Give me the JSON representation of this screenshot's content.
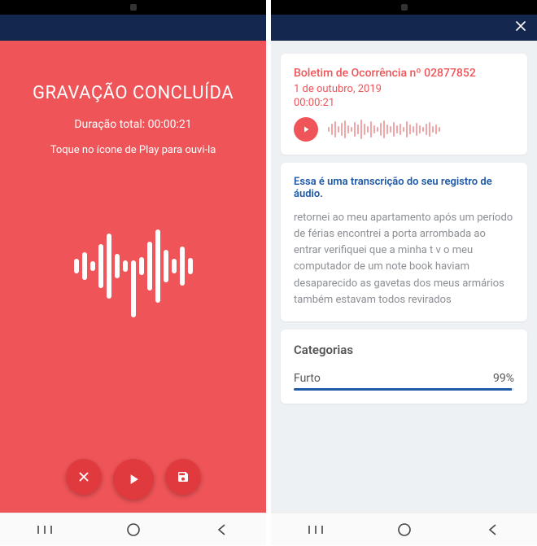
{
  "left": {
    "title": "GRAVAÇÃO CONCLUÍDA",
    "duration_label": "Duração total: 00:00:21",
    "hint": "Toque no ícone de Play para ouvi-la"
  },
  "right": {
    "report_title": "Boletim de Ocorrência nº 02877852",
    "report_date": "1 de outubro, 2019",
    "report_duration": "00:00:21",
    "transcription_title": "Essa é uma transcrição do seu registro de áudio.",
    "transcription_body": "retornei ao meu apartamento após um período de férias encontrei a porta arrombada ao entrar verifiquei que a minha t v o meu computador de um note book haviam desaparecido as gavetas dos meus armários também estavam todos revirados",
    "categories_title": "Categorias",
    "category_name": "Furto",
    "category_pct_label": "99%",
    "category_pct": 99
  }
}
